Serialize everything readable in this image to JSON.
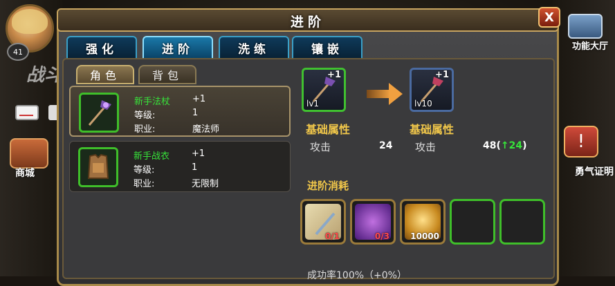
{
  "window": {
    "title": "进阶",
    "close_label": "X"
  },
  "hud": {
    "level": "41",
    "battle_text": "战斗",
    "shop_label": "商城",
    "function_label": "功能大厅",
    "brave_label": "勇气证明",
    "brave_icon": "!"
  },
  "tabs": [
    {
      "label": "强化",
      "active": false
    },
    {
      "label": "进阶",
      "active": true
    },
    {
      "label": "洗练",
      "active": false
    },
    {
      "label": "镶嵌",
      "active": false
    }
  ],
  "subtabs": [
    {
      "label": "角色",
      "active": true
    },
    {
      "label": "背包",
      "active": false
    }
  ],
  "items": [
    {
      "name": "新手法杖",
      "plus": "+1",
      "level_label": "等级:",
      "level": "1",
      "job_label": "职业:",
      "job": "魔法师",
      "selected": true,
      "icon": "staff-icon"
    },
    {
      "name": "新手战衣",
      "plus": "+1",
      "level_label": "等级:",
      "level": "1",
      "job_label": "职业:",
      "job": "无限制",
      "selected": false,
      "icon": "armor-icon"
    }
  ],
  "upgrade": {
    "from": {
      "plus": "+1",
      "level": "lv1"
    },
    "to": {
      "plus": "+1",
      "level": "lv10"
    },
    "attr_title": "基础属性",
    "attack_label": "攻击",
    "attack_before": "24",
    "attack_after": "48(",
    "attack_gain": "↑24",
    "attack_close": ")"
  },
  "cost": {
    "title": "进阶消耗",
    "materials": [
      {
        "icon": "scroll-icon",
        "count": "0/1",
        "color": "red"
      },
      {
        "icon": "crystal-icon",
        "count": "0/3",
        "color": "red"
      },
      {
        "icon": "coin-icon",
        "count": "10000",
        "color": "white"
      },
      {
        "icon": "empty-slot",
        "count": "",
        "color": "white"
      },
      {
        "icon": "empty-slot",
        "count": "",
        "color": "white"
      }
    ]
  },
  "success_rate": "成功率100%（+0%）",
  "colors": {
    "accent_green": "#37e43a",
    "gold": "#f2c84a",
    "tab_blue": "#3aa0c8"
  }
}
